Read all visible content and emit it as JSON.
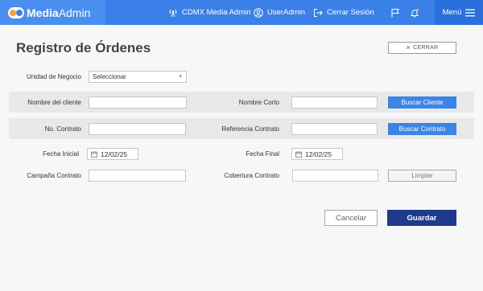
{
  "header": {
    "brand_bold": "Media",
    "brand_light": "Admin",
    "location": "CDMX Media Admin",
    "user": "UserAdmin",
    "logout": "Cerrar Sesión",
    "menu": "Menú",
    "colors": {
      "bar": "#3a80e8",
      "brand_bg": "#4a8ff0",
      "menu_bg": "#2a6fdc"
    }
  },
  "page": {
    "title": "Registro de Órdenes",
    "close_label": "CERRAR"
  },
  "form": {
    "unidad_label": "Unidad de Negocio",
    "unidad_value": "Seleccionar",
    "nombre_cliente_label": "Nombre del cliente",
    "nombre_corto_label": "Nombre Corto",
    "buscar_cliente": "Buscar Cliente",
    "no_contrato_label": "No. Contrato",
    "referencia_label": "Referencia Contrato",
    "buscar_contrato": "Buscar Contrato",
    "fecha_inicial_label": "Fecha Inicial",
    "fecha_inicial_value": "12/02/25",
    "fecha_final_label": "Fecha Final",
    "fecha_final_value": "12/02/25",
    "campana_label": "Campaña Contrato",
    "cobertura_label": "Cobertura Contrato",
    "limpiar": "Limpiar"
  },
  "actions": {
    "cancel": "Cancelar",
    "save": "Guardar"
  },
  "colors": {
    "primary_button": "#3a85e6",
    "save_button": "#1f3a8a"
  }
}
